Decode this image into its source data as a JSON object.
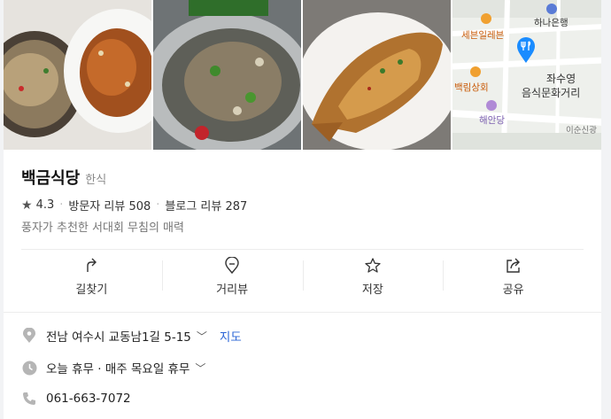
{
  "restaurant": {
    "name": "백금식당",
    "category": "한식",
    "rating": "4.3",
    "visitor_reviews": "방문자 리뷰 508",
    "blog_reviews": "블로그 리뷰 287",
    "description": "풍자가 추천한 서대회 무침의 매력"
  },
  "map": {
    "labels": [
      "하나은행",
      "세븐일레븐",
      "백림상회",
      "해안당",
      "좌수영",
      "음식문화거리",
      "이순신광"
    ]
  },
  "actions": [
    {
      "label": "길찾기",
      "icon": "directions-icon"
    },
    {
      "label": "거리뷰",
      "icon": "street-view-icon"
    },
    {
      "label": "저장",
      "icon": "star-icon"
    },
    {
      "label": "공유",
      "icon": "share-icon"
    }
  ],
  "info": {
    "address": "전남 여수시 교동남1길 5-15",
    "map_link": "지도",
    "hours": "오늘 휴무 · 매주 목요일 휴무",
    "phone": "061-663-7072"
  },
  "colors": {
    "accent": "#2a64d6",
    "pin": "#1a8cff",
    "icon_gray": "#b5b5b5"
  }
}
